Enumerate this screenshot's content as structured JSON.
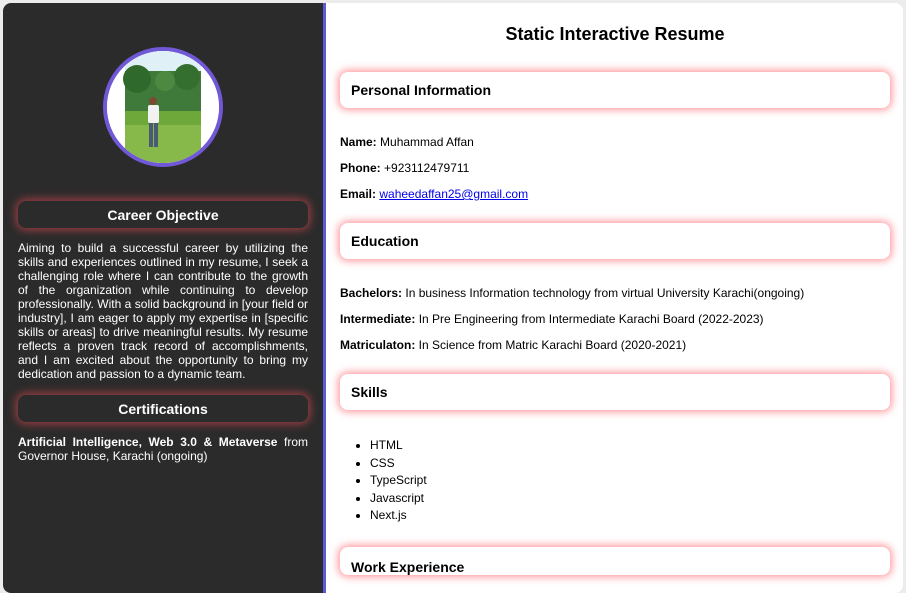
{
  "sidebar": {
    "profile_image": "profile-photo",
    "career_heading": "Career Objective",
    "career_text": "Aiming to build a successful career by utilizing the skills and experiences outlined in my resume, I seek a challenging role where I can contribute to the growth of the organization while continuing to develop professionally. With a solid background in [your field or industry], I am eager to apply my expertise in [specific skills or areas] to drive meaningful results. My resume reflects a proven track record of accomplishments, and I am excited about the opportunity to bring my dedication and passion to a dynamic team.",
    "cert_heading": "Certifications",
    "cert_bold": "Artificial Intelligence, Web 3.0 & Metaverse",
    "cert_rest": " from Governor House, Karachi (ongoing)"
  },
  "main": {
    "title": "Static Interactive Resume",
    "personal": {
      "heading": "Personal Information",
      "name_label": "Name:",
      "name_value": " Muhammad Affan",
      "phone_label": "Phone:",
      "phone_value": " +923112479711",
      "email_label": "Email:",
      "email_value": "waheedaffan25@gmail.com"
    },
    "education": {
      "heading": "Education",
      "items": [
        {
          "label": "Bachelors:",
          "value": " In business Information technology from virtual University Karachi(ongoing)"
        },
        {
          "label": "Intermediate:",
          "value": " In Pre Engineering from Intermediate Karachi Board (2022-2023)"
        },
        {
          "label": "Matriculaton:",
          "value": " In Science from Matric Karachi Board (2020-2021)"
        }
      ]
    },
    "skills": {
      "heading": "Skills",
      "items": [
        "HTML",
        "CSS",
        "TypeScript",
        "Javascript",
        "Next.js"
      ]
    },
    "work": {
      "heading": "Work Experience"
    }
  },
  "colors": {
    "sidebar_bg": "#2b2b2b",
    "accent_border": "#5b5bd6",
    "avatar_ring": "#7058d6",
    "glow": "#ff505a",
    "link": "#0000ee"
  }
}
